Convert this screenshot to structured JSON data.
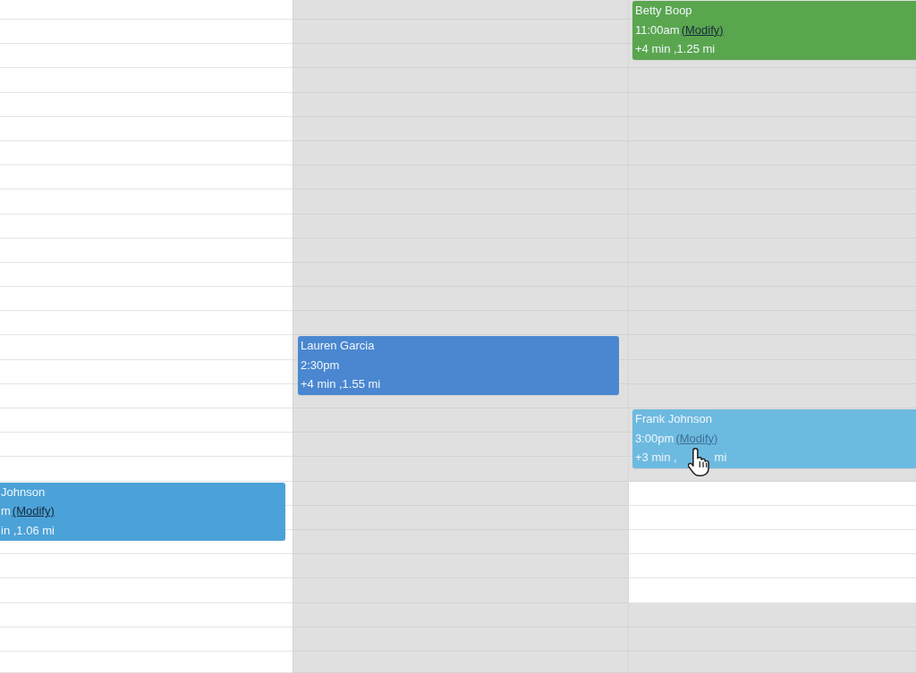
{
  "calendar": {
    "columns": [
      {
        "slots": [
          {
            "shaded": false
          },
          {
            "shaded": false
          },
          {
            "shaded": false
          },
          {
            "shaded": false
          },
          {
            "shaded": false
          },
          {
            "shaded": false
          },
          {
            "shaded": false
          },
          {
            "shaded": false
          },
          {
            "shaded": false
          },
          {
            "shaded": false
          },
          {
            "shaded": false
          },
          {
            "shaded": false
          },
          {
            "shaded": false
          },
          {
            "shaded": false
          },
          {
            "shaded": false
          },
          {
            "shaded": false
          },
          {
            "shaded": false
          },
          {
            "shaded": false
          },
          {
            "shaded": false
          },
          {
            "shaded": false
          },
          {
            "shaded": false,
            "event": {
              "name": "Johnson",
              "time": "m",
              "link": "(Modify)",
              "travel": [
                "in ,1.06 mi"
              ],
              "pointer_over": false,
              "color": "#4ba2d8"
            }
          },
          {
            "shaded": false
          },
          {
            "shaded": false
          },
          {
            "shaded": false
          },
          {
            "shaded": false
          },
          {
            "shaded": false
          },
          {
            "shaded": false
          },
          {
            "shaded": false
          }
        ]
      },
      {
        "slots": [
          {
            "shaded": true
          },
          {
            "shaded": true
          },
          {
            "shaded": true
          },
          {
            "shaded": true
          },
          {
            "shaded": true
          },
          {
            "shaded": true
          },
          {
            "shaded": true
          },
          {
            "shaded": true
          },
          {
            "shaded": true
          },
          {
            "shaded": true
          },
          {
            "shaded": true
          },
          {
            "shaded": true
          },
          {
            "shaded": true
          },
          {
            "shaded": true
          },
          {
            "shaded": true,
            "event": {
              "name": "Lauren Garcia",
              "time": "2:30pm",
              "travel": [
                "+4 min ,1.55 mi"
              ],
              "pointer_over": false,
              "color": "#4a87d0"
            }
          },
          {
            "shaded": true
          },
          {
            "shaded": true
          },
          {
            "shaded": true
          },
          {
            "shaded": true
          },
          {
            "shaded": true
          },
          {
            "shaded": true
          },
          {
            "shaded": true
          },
          {
            "shaded": true
          },
          {
            "shaded": true
          },
          {
            "shaded": true
          },
          {
            "shaded": true
          },
          {
            "shaded": true
          },
          {
            "shaded": true
          }
        ]
      },
      {
        "slots": [
          {
            "shaded": true,
            "event": {
              "name": "Betty Boop",
              "time": "11:00am",
              "link": "(Modify)",
              "travel": [
                "+4 min ,1.25 mi"
              ],
              "pointer_over": false,
              "color": "#5aa64f"
            }
          },
          {
            "shaded": true
          },
          {
            "shaded": true
          },
          {
            "shaded": true
          },
          {
            "shaded": true
          },
          {
            "shaded": true
          },
          {
            "shaded": true
          },
          {
            "shaded": true
          },
          {
            "shaded": true
          },
          {
            "shaded": true
          },
          {
            "shaded": true
          },
          {
            "shaded": true
          },
          {
            "shaded": true
          },
          {
            "shaded": true
          },
          {
            "shaded": true
          },
          {
            "shaded": true
          },
          {
            "shaded": true
          },
          {
            "shaded": true,
            "event": {
              "name": "Frank Johnson",
              "time": "3:00pm",
              "link": "(Modify)",
              "travel": [
                "+3 min ,",
                "mi"
              ],
              "pointer_over": true,
              "color": "#6dbae0"
            }
          },
          {
            "shaded": true
          },
          {
            "shaded": true
          },
          {
            "shaded": false
          },
          {
            "shaded": false
          },
          {
            "shaded": false
          },
          {
            "shaded": false
          },
          {
            "shaded": false
          },
          {
            "shaded": true
          },
          {
            "shaded": true
          },
          {
            "shaded": true
          }
        ]
      }
    ]
  }
}
